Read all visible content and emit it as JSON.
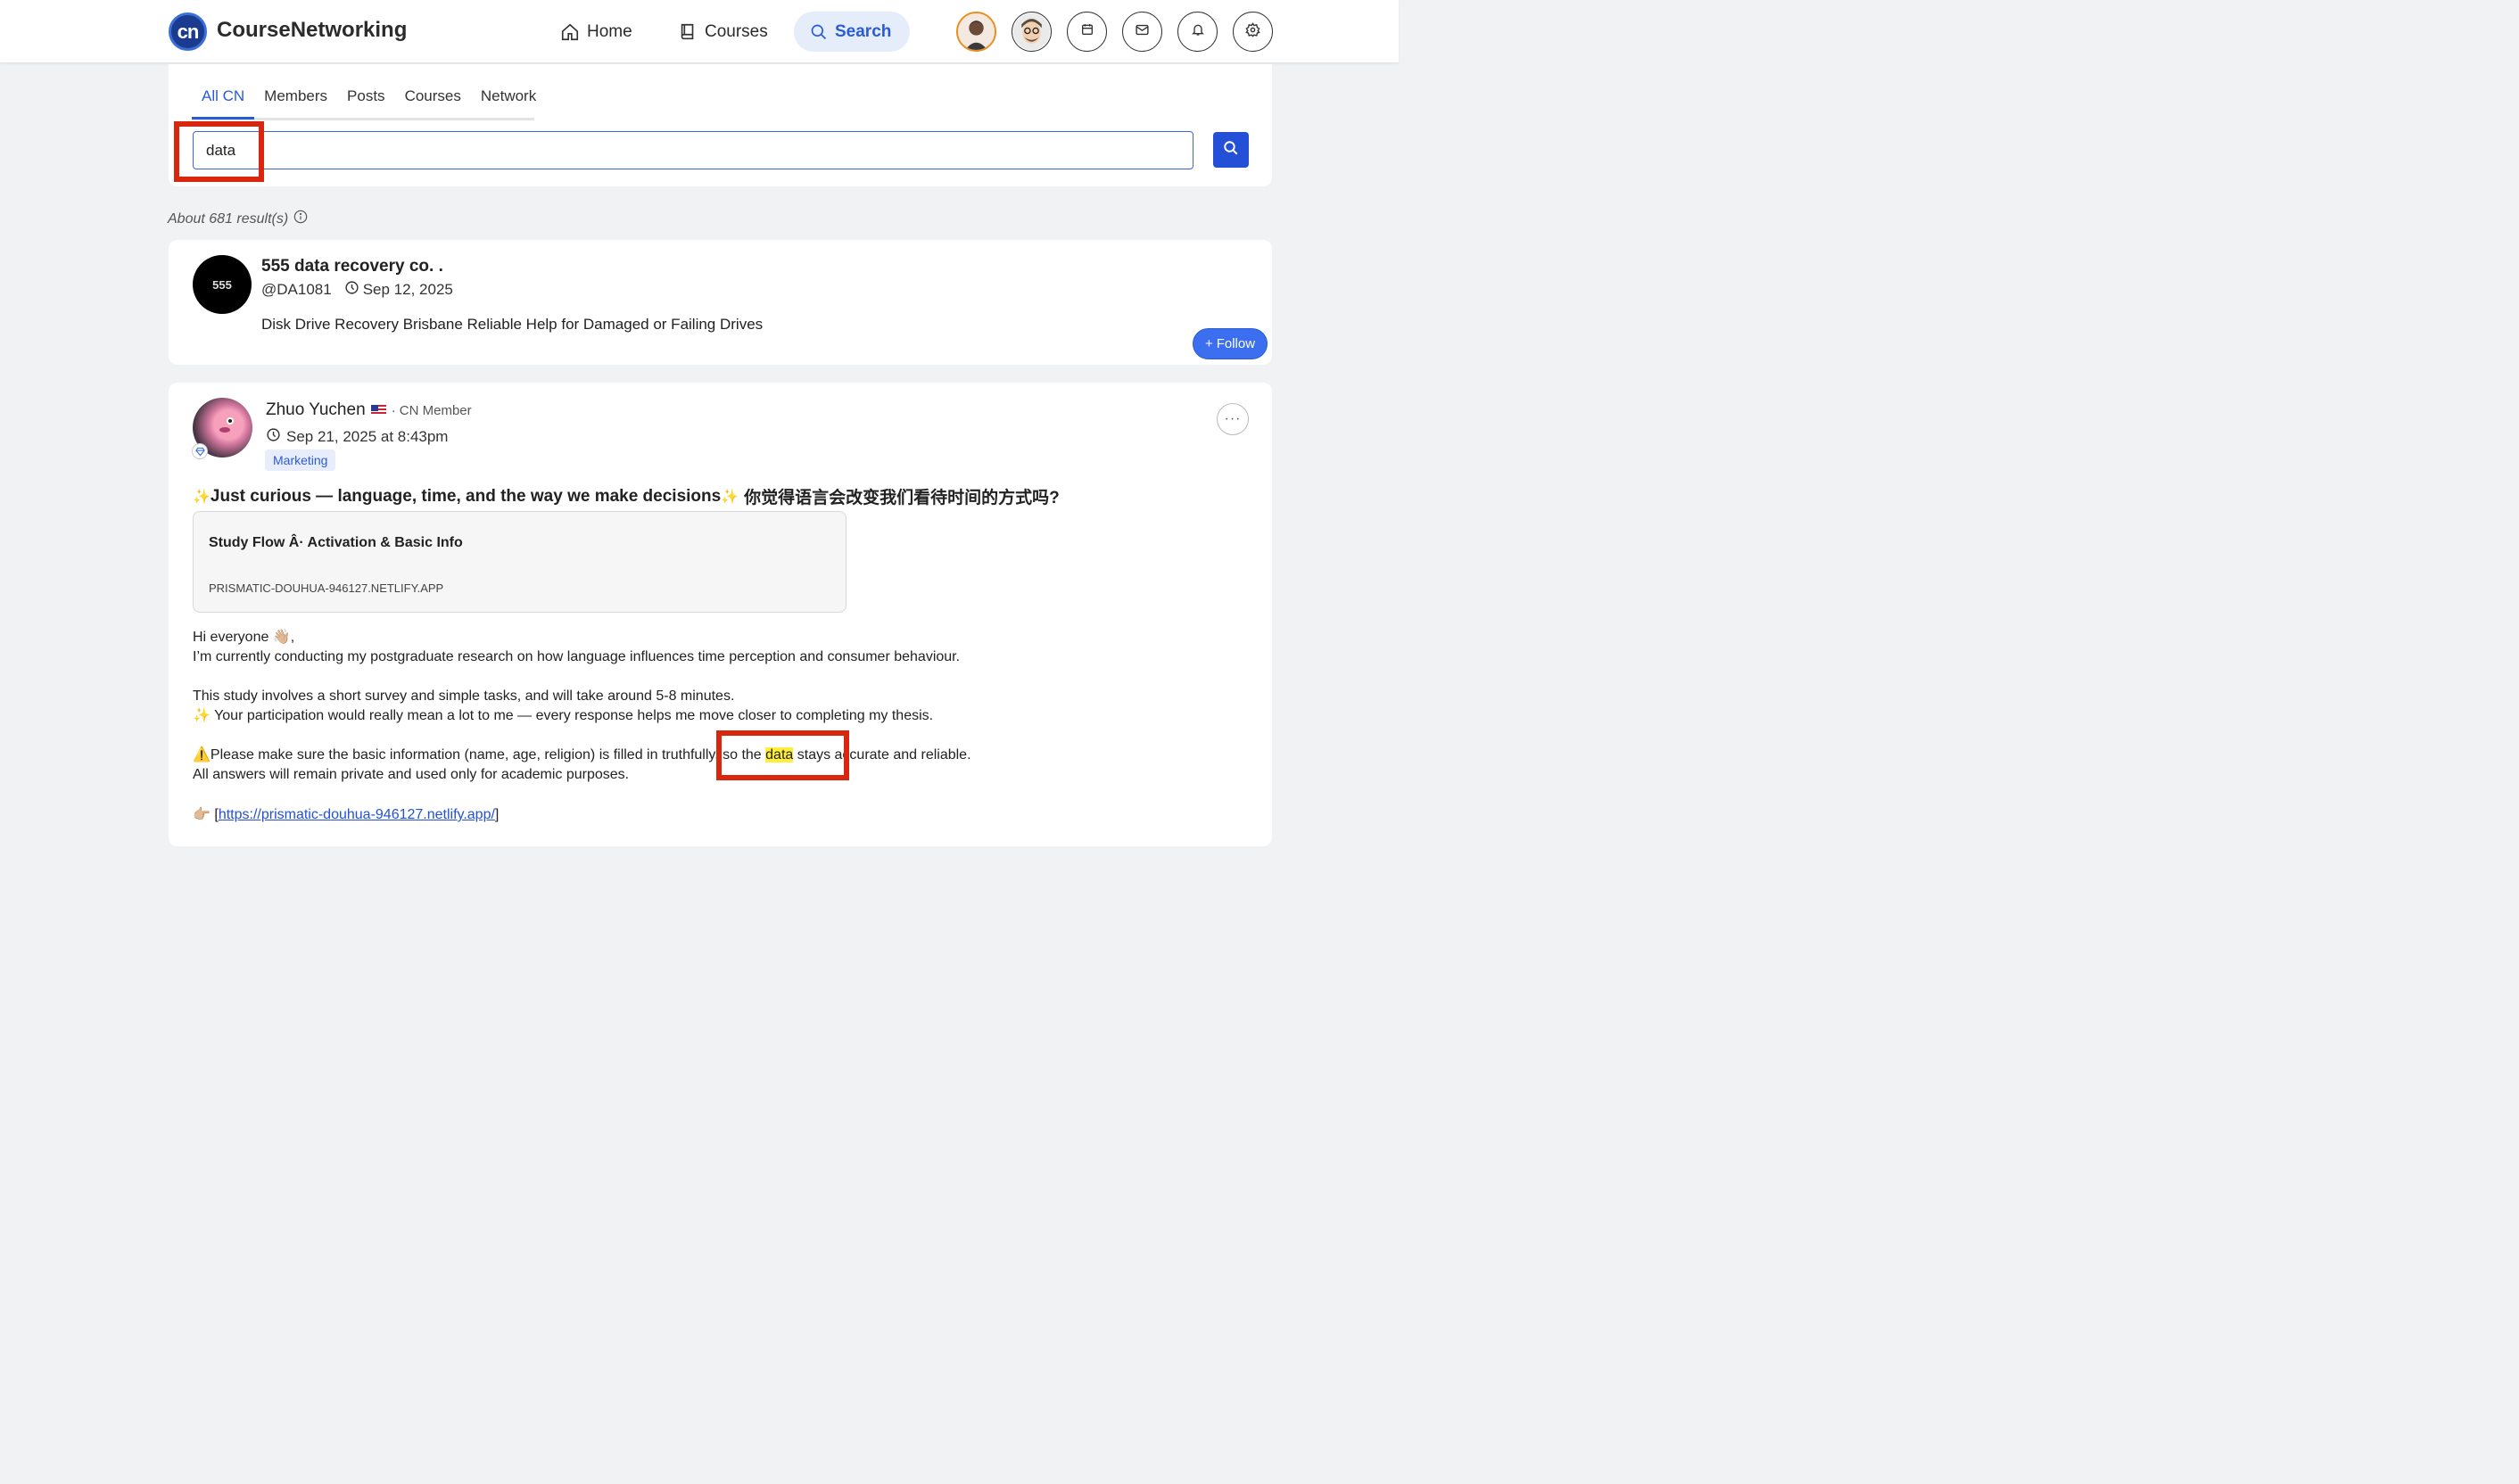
{
  "header": {
    "logo_text": "cn",
    "brand": "CourseNetworking",
    "nav": [
      {
        "label": "Home",
        "icon": "home-icon"
      },
      {
        "label": "Courses",
        "icon": "book-icon"
      },
      {
        "label": "Search",
        "icon": "search-icon",
        "active": true
      }
    ],
    "icons": [
      "calendar-icon",
      "mail-icon",
      "bell-icon",
      "gear-icon"
    ]
  },
  "search": {
    "tabs": [
      "All CN",
      "Members",
      "Posts",
      "Courses",
      "Network"
    ],
    "active_tab": "All CN",
    "query": "data",
    "results_count": "About 681 result(s)"
  },
  "results": [
    {
      "avatar_text": "555",
      "title": "555 data recovery co. .",
      "handle": "@DA1081",
      "date": "Sep 12, 2025",
      "description": "Disk Drive Recovery Brisbane Reliable Help for Damaged or Failing Drives",
      "follow_label": "Follow"
    }
  ],
  "post": {
    "author": "Zhuo Yuchen",
    "role": "· CN Member",
    "date": "Sep 21, 2025 at 8:43pm",
    "tag": "Marketing",
    "title": "Just curious — language, time, and the way we make decisions",
    "title_cn": "你觉得语言会改变我们看待时间的方式吗?",
    "link_preview": {
      "title": "Study Flow Â· Activation & Basic Info",
      "url": "PRISMATIC-DOUHUA-946127.NETLIFY.APP"
    },
    "lines": {
      "greeting": "Hi everyone 👋🏼,",
      "l1": "I’m currently conducting my postgraduate research on how language influences time perception and consumer behaviour.",
      "l2": "This study involves a short survey and simple tasks, and will take around 5-8 minutes.",
      "l3": " Your participation would really mean a lot to me — every response helps me move closer to completing my thesis.",
      "l4_a": "Please make sure the basic information (name, age, religion) is filled in truthfully, so the ",
      "l4_hl": "data",
      "l4_b": " stays accurate and reliable.",
      "l5": "All answers will remain private and used only for academic purposes.",
      "link": "https://prismatic-douhua-946127.netlify.app/"
    }
  },
  "colors": {
    "accent": "#2a5bd7",
    "highlight_box": "#d9260f",
    "search_highlight": "#ffef3a"
  }
}
